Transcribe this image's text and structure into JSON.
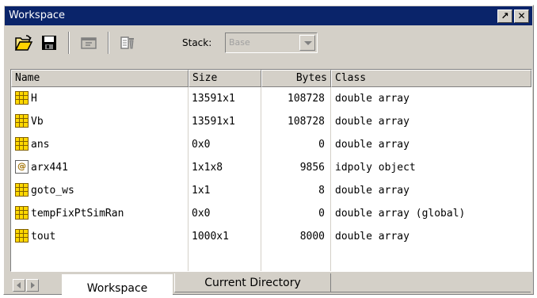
{
  "window": {
    "title": "Workspace",
    "buttons": {
      "undock": "↗",
      "close": "✕"
    }
  },
  "toolbar": {
    "icons": [
      "open-folder-icon",
      "save-icon",
      "open-selection-icon",
      "delete-icon"
    ],
    "stack_label": "Stack:",
    "stack_value": "Base"
  },
  "table": {
    "columns": [
      "Name",
      "Size",
      "Bytes",
      "Class"
    ],
    "rows": [
      {
        "icon": "array-icon",
        "name": "H",
        "size": "13591x1",
        "bytes": "108728",
        "class": "double array"
      },
      {
        "icon": "array-icon",
        "name": "Vb",
        "size": "13591x1",
        "bytes": "108728",
        "class": "double array"
      },
      {
        "icon": "array-icon",
        "name": "ans",
        "size": "0x0",
        "bytes": "0",
        "class": "double array"
      },
      {
        "icon": "object-icon",
        "name": "arx441",
        "size": "1x1x8",
        "bytes": "9856",
        "class": "idpoly object"
      },
      {
        "icon": "array-icon",
        "name": "goto_ws",
        "size": "1x1",
        "bytes": "8",
        "class": "double array"
      },
      {
        "icon": "array-icon",
        "name": "tempFixPtSimRan",
        "size": "0x0",
        "bytes": "0",
        "class": "double array (global)"
      },
      {
        "icon": "array-icon",
        "name": "tout",
        "size": "1000x1",
        "bytes": "8000",
        "class": "double array"
      }
    ]
  },
  "tabs": {
    "workspace": "Workspace",
    "current_directory": "Current Directory"
  },
  "colors": {
    "titlebar": "#0a246a",
    "chrome": "#d4d0c8",
    "array_icon": "#ffd800"
  }
}
